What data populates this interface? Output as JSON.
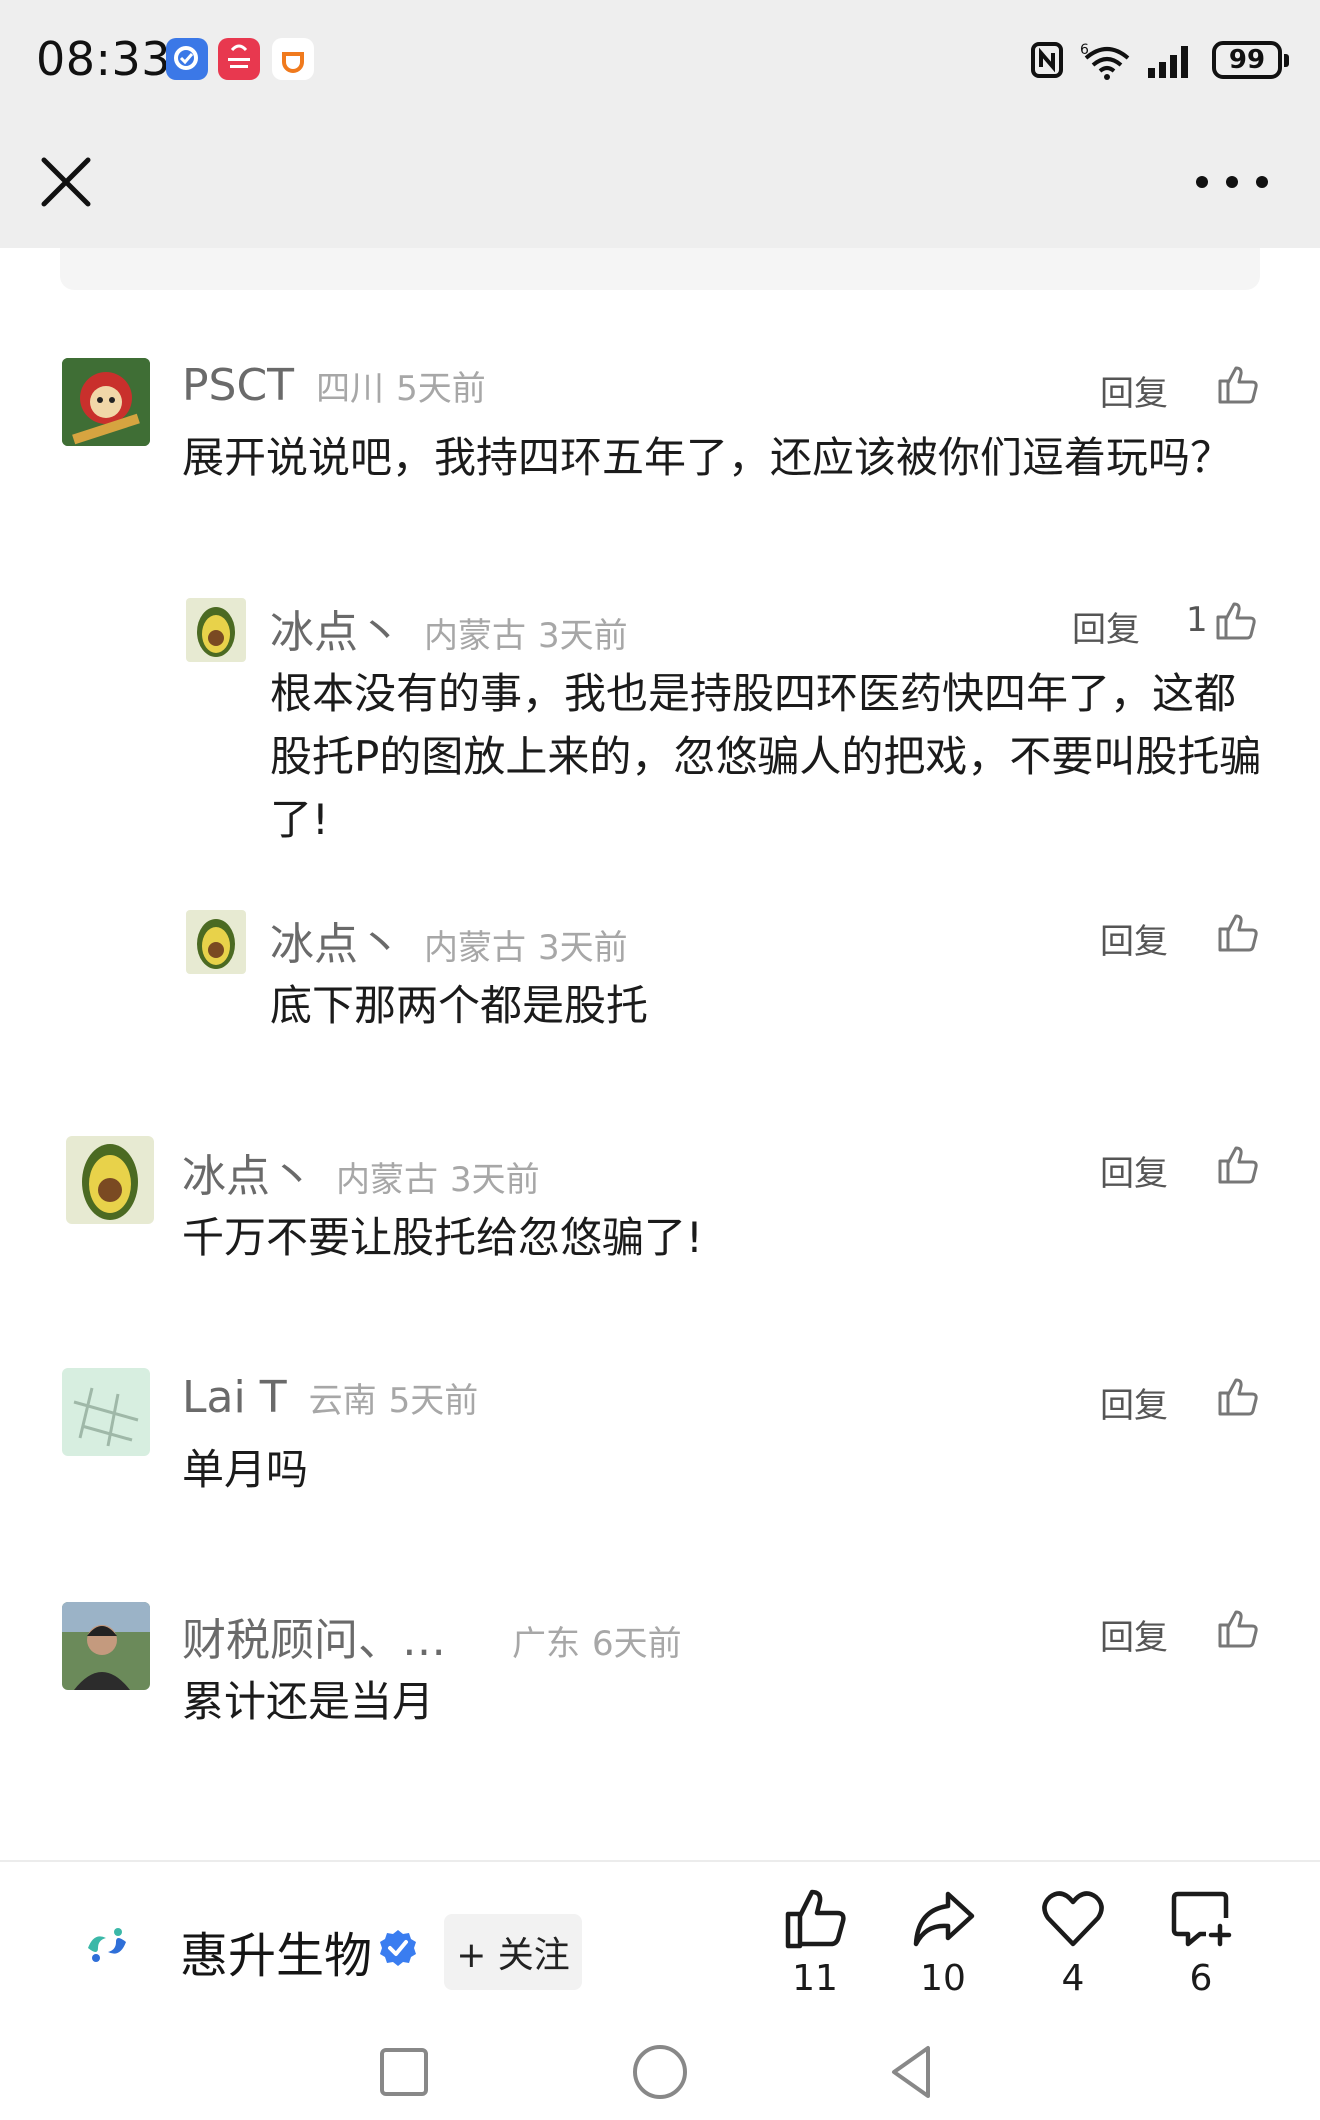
{
  "status_bar": {
    "time": "08:33",
    "battery": "99",
    "wifi_label": "6"
  },
  "top_nav": {
    "close_icon": "close-icon",
    "more_icon": "more-icon"
  },
  "comments": [
    {
      "name": "PSCT",
      "location": "四川",
      "time": "5天前",
      "text": "展开说说吧，我持四环五年了，还应该被你们逗着玩吗？",
      "reply_label": "回复",
      "likes": ""
    },
    {
      "name": "冰点丶",
      "location": "内蒙古",
      "time": "3天前",
      "text": "根本没有的事，我也是持股四环医药快四年了，这都股托P的图放上来的，忽悠骗人的把戏，不要叫股托骗了!",
      "reply_label": "回复",
      "likes": "1"
    },
    {
      "name": "冰点丶",
      "location": "内蒙古",
      "time": "3天前",
      "text": "底下那两个都是股托",
      "reply_label": "回复",
      "likes": ""
    },
    {
      "name": "冰点丶",
      "location": "内蒙古",
      "time": "3天前",
      "text": "千万不要让股托给忽悠骗了!",
      "reply_label": "回复",
      "likes": ""
    },
    {
      "name": "Lai T",
      "location": "云南",
      "time": "5天前",
      "text": "单月吗",
      "reply_label": "回复",
      "likes": ""
    },
    {
      "name": "财税顾问、…",
      "location": "广东",
      "time": "6天前",
      "text": "累计还是当月",
      "reply_label": "回复",
      "likes": ""
    }
  ],
  "bottom_bar": {
    "author": "惠升生物",
    "follow_label": "+ 关注",
    "like_count": "11",
    "share_count": "10",
    "favorite_count": "4",
    "comment_count": "6"
  },
  "colors": {
    "top_bar_bg": "#eeeeee",
    "meta_gray": "#a7a7a7",
    "verify_blue": "#3a7df0",
    "brand_logo_teal": "#3bb8a8",
    "brand_logo_blue": "#2f6fd8"
  }
}
